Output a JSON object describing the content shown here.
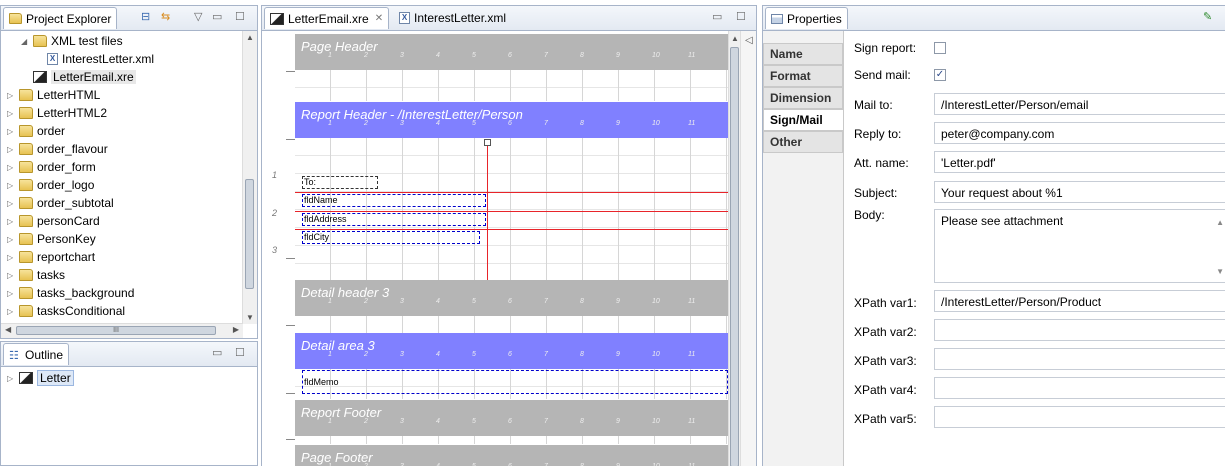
{
  "explorer": {
    "tab_label": "Project Explorer",
    "items": [
      {
        "label": "XML test files",
        "type": "folder",
        "expanded": true,
        "depth": 1
      },
      {
        "label": "InterestLetter.xml",
        "type": "xml",
        "depth": 2
      },
      {
        "label": "LetterEmail.xre",
        "type": "report",
        "depth": 1,
        "selected": true
      },
      {
        "label": "LetterHTML",
        "type": "folder",
        "depth": 0
      },
      {
        "label": "LetterHTML2",
        "type": "folder",
        "depth": 0
      },
      {
        "label": "order",
        "type": "folder",
        "depth": 0
      },
      {
        "label": "order_flavour",
        "type": "folder",
        "depth": 0
      },
      {
        "label": "order_form",
        "type": "folder",
        "depth": 0
      },
      {
        "label": "order_logo",
        "type": "folder",
        "depth": 0
      },
      {
        "label": "order_subtotal",
        "type": "folder",
        "depth": 0
      },
      {
        "label": "personCard",
        "type": "folder",
        "depth": 0
      },
      {
        "label": "PersonKey",
        "type": "folder",
        "depth": 0
      },
      {
        "label": "reportchart",
        "type": "folder",
        "depth": 0
      },
      {
        "label": "tasks",
        "type": "folder",
        "depth": 0
      },
      {
        "label": "tasks_background",
        "type": "folder",
        "depth": 0
      },
      {
        "label": "tasksConditional",
        "type": "folder",
        "depth": 0
      }
    ],
    "hscroll_label": "III"
  },
  "outline": {
    "tab_label": "Outline",
    "items": [
      {
        "label": "Letter"
      }
    ]
  },
  "editor": {
    "tabs": [
      {
        "label": "LetterEmail.xre",
        "active": true
      },
      {
        "label": "InterestLetter.xml",
        "active": false
      }
    ],
    "ruler_numbers": [
      "1",
      "2",
      "3",
      "4",
      "5",
      "6",
      "7",
      "8",
      "9",
      "10",
      "11"
    ],
    "bands": {
      "page_header": "Page Header",
      "report_header": "Report Header  - /InterestLetter/Person",
      "detail_header": "Detail header 3",
      "detail_area": "Detail area 3",
      "report_footer": "Report Footer",
      "page_footer": "Page Footer"
    },
    "side_numbers": [
      "1",
      "2",
      "3"
    ],
    "fields": {
      "to": "To:",
      "name": "fldName",
      "address": "fldAddress",
      "city": "fldCity",
      "memo": "fldMemo"
    }
  },
  "properties": {
    "tab_label": "Properties",
    "side_tabs": [
      {
        "label": "Name",
        "active": false
      },
      {
        "label": "Format",
        "active": false
      },
      {
        "label": "Dimension",
        "active": false
      },
      {
        "label": "Sign/Mail",
        "active": true
      },
      {
        "label": "Other",
        "active": false
      }
    ],
    "sign_report_label": "Sign report:",
    "sign_report_checked": false,
    "send_mail_label": "Send mail:",
    "send_mail_checked": true,
    "mail_to_label": "Mail to:",
    "mail_to": "/InterestLetter/Person/email",
    "reply_to_label": "Reply to:",
    "reply_to": "peter@company.com",
    "att_name_label": "Att. name:",
    "att_name": "'Letter.pdf'",
    "subject_label": "Subject:",
    "subject": "Your request about %1",
    "body_label": "Body:",
    "body": "Please see attachment",
    "xpath_vars": [
      {
        "label": "XPath var1:",
        "value": "/InterestLetter/Person/Product"
      },
      {
        "label": "XPath var2:",
        "value": ""
      },
      {
        "label": "XPath var3:",
        "value": ""
      },
      {
        "label": "XPath var4:",
        "value": ""
      },
      {
        "label": "XPath var5:",
        "value": ""
      }
    ]
  },
  "colors": {
    "band_blue": "#8080ff",
    "band_gray": "#b5b5b5",
    "guide_red": "#e8242a",
    "selection_blue": "#0000cc"
  }
}
